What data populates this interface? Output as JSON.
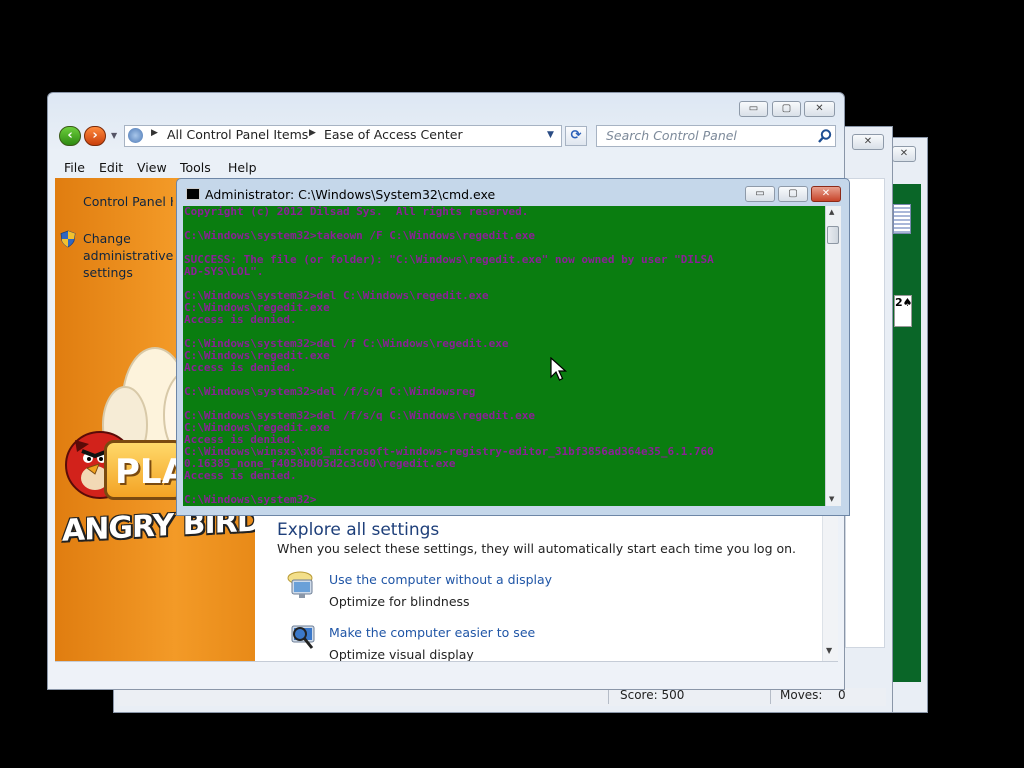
{
  "solitaire": {
    "close_label": "✕",
    "card_label": "2♠",
    "score_label": "Score: 500",
    "moves_label": "Moves:",
    "moves_value": "0"
  },
  "control_panel": {
    "window_buttons": {
      "minimize": "▭",
      "maximize": "▢",
      "close": "✕"
    },
    "breadcrumb": [
      "All Control Panel Items",
      "Ease of Access Center"
    ],
    "search_placeholder": "Search Control Panel",
    "menu": [
      "File",
      "Edit",
      "View",
      "Tools",
      "Help"
    ],
    "sidebar": {
      "title": "Control Panel Home",
      "link": "Change administrative settings"
    },
    "main": {
      "heading": "Explore all settings",
      "description": "When you select these settings, they will automatically start each time you log on.",
      "options": [
        {
          "link": "Use the computer without a display",
          "desc": "Optimize for blindness"
        },
        {
          "link": "Make the computer easier to see",
          "desc": "Optimize visual display"
        }
      ]
    },
    "art": {
      "title": "ANGRY BIRDS",
      "play": "PLA"
    }
  },
  "cmd": {
    "title": "Administrator: C:\\Windows\\System32\\cmd.exe",
    "window_buttons": {
      "minimize": "▭",
      "maximize": "▢",
      "close": "✕"
    },
    "lines": [
      "Copyright (c) 2012 Dilsad Sys.  All rights reserved.",
      "",
      "C:\\Windows\\system32>takeown /F C:\\Windows\\regedit.exe",
      "",
      "SUCCESS: The file (or folder): \"C:\\Windows\\regedit.exe\" now owned by user \"DILSA",
      "AD-SYS\\LOL\".",
      "",
      "C:\\Windows\\system32>del C:\\Windows\\regedit.exe",
      "C:\\Windows\\regedit.exe",
      "Access is denied.",
      "",
      "C:\\Windows\\system32>del /f C:\\Windows\\regedit.exe",
      "C:\\Windows\\regedit.exe",
      "Access is denied.",
      "",
      "C:\\Windows\\system32>del /f/s/q C:\\Windowsreg",
      "",
      "C:\\Windows\\system32>del /f/s/q C:\\Windows\\regedit.exe",
      "C:\\Windows\\regedit.exe",
      "Access is denied.",
      "C:\\Windows\\winsxs\\x86_microsoft-windows-registry-editor_31bf3856ad364e35_6.1.760",
      "0.16385_none_f4058b003d2c3c00\\regedit.exe",
      "Access is denied.",
      "",
      "C:\\Windows\\system32>"
    ]
  }
}
